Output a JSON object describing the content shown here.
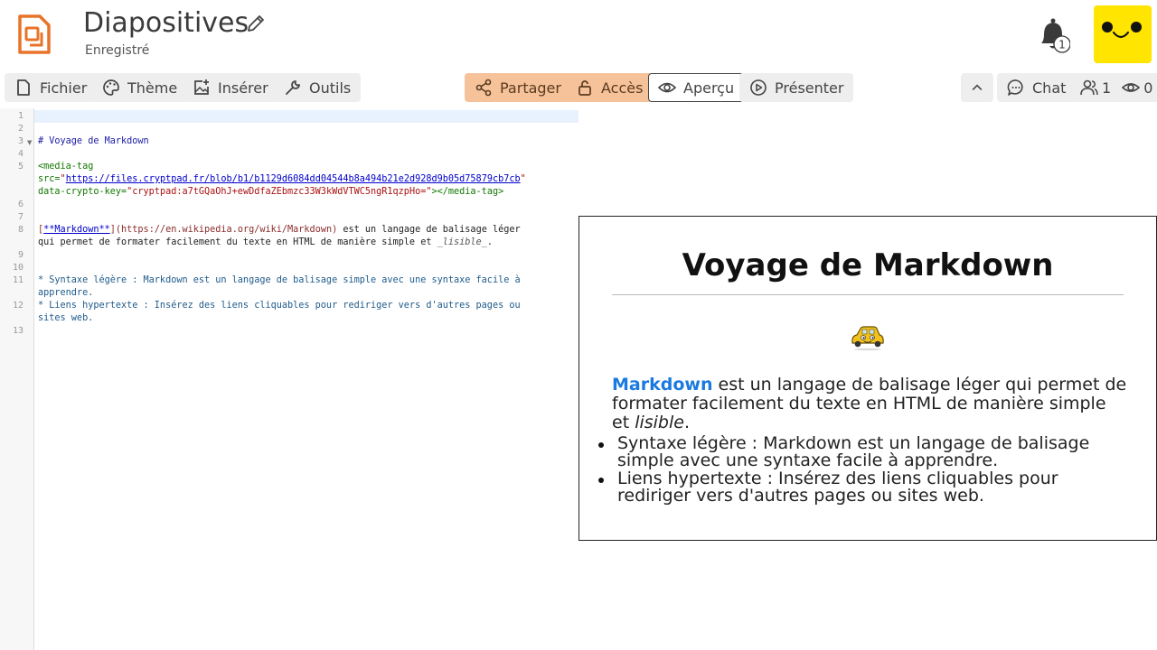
{
  "header": {
    "title": "Diapositives",
    "status": "Enregistré",
    "notification_count": "1"
  },
  "toolbar": {
    "left": [
      {
        "label": "Fichier",
        "icon": "file-icon"
      },
      {
        "label": "Thème",
        "icon": "palette-icon"
      },
      {
        "label": "Insérer",
        "icon": "image-add-icon"
      },
      {
        "label": "Outils",
        "icon": "wrench-icon"
      }
    ],
    "center": [
      {
        "label": "Partager",
        "icon": "share-icon"
      },
      {
        "label": "Accès",
        "icon": "lock-icon"
      },
      {
        "label": "Aperçu",
        "icon": "eye-icon"
      },
      {
        "label": "Présenter",
        "icon": "play-icon"
      }
    ],
    "right": {
      "chat_label": "Chat",
      "users_count": "1",
      "viewers_count": "0"
    }
  },
  "editor": {
    "line_numbers": [
      "1",
      "2",
      "3",
      "4",
      "5",
      "6",
      "7",
      "8",
      "9",
      "10",
      "11",
      "12",
      "13"
    ],
    "lines": {
      "l3": "# Voyage de Markdown",
      "l5a": "<media-tag",
      "l5b_attr": "src=",
      "l5b_url": "https://files.cryptpad.fr/blob/b1/b1129d6084dd04544b8a494b21e2d928d9b05d75879cb7cb",
      "l5c_attr": "data-crypto-key=",
      "l5c_val": "\"cryptpad:a7tGQaOhJ+ewDdfaZEbmzc33W3kWdVTWC5ngR1qzpHo=\"",
      "l5c_close": "></media-tag>",
      "l8_link": "**Markdown**",
      "l8_url": "(https://en.wikipedia.org/wiki/Markdown)",
      "l8_rest": " est un langage de balisage léger",
      "l8_line2a": "qui permet de formater facilement du texte en HTML de manière simple et ",
      "l8_em": "_lisible_",
      "l8_end": ".",
      "l11a": "* Syntaxe légère : Markdown est un langage de balisage simple avec une syntaxe facile à",
      "l11b": "apprendre.",
      "l12a": "* Liens hypertexte : Insérez des liens cliquables pour rediriger vers d'autres pages ou",
      "l12b": "sites web."
    }
  },
  "preview": {
    "title": "Voyage de Markdown",
    "media_icon": "taxi-icon",
    "link_text": "Markdown",
    "paragraph_rest": " est un langage de balisage léger qui permet de formater facilement du texte en HTML de manière simple et ",
    "paragraph_em": "lisible",
    "paragraph_end": ".",
    "bullets": [
      "Syntaxe légère : Markdown est un langage de balisage simple avec une syntaxe facile à apprendre.",
      "Liens hypertexte : Insérez des liens cliquables pour rediriger vers d'autres pages ou sites web."
    ]
  },
  "colors": {
    "accent_orange": "#f6c29a",
    "app_icon_orange": "#e8742a",
    "avatar_yellow": "#ffe500",
    "link_blue": "#1a7ae0"
  }
}
